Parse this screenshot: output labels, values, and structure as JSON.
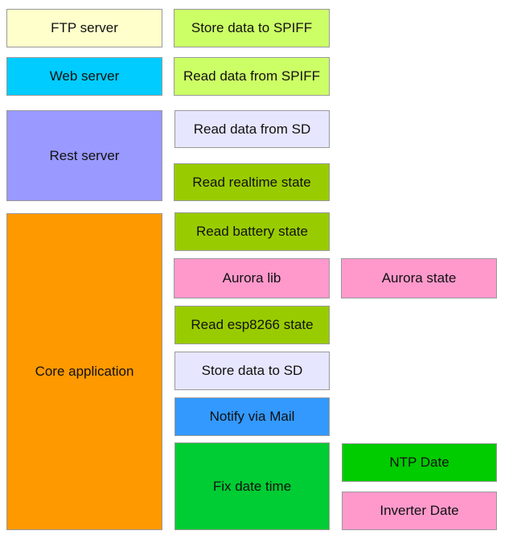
{
  "diagram": {
    "boxes": {
      "ftp_server": {
        "label": "FTP server",
        "color": "#ffffcc"
      },
      "web_server": {
        "label": "Web server",
        "color": "#00ccff"
      },
      "rest_server": {
        "label": "Rest server",
        "color": "#9999ff"
      },
      "core_application": {
        "label": "Core application",
        "color": "#ff9900"
      },
      "store_spiff": {
        "label": "Store data to SPIFF",
        "color": "#ccff66"
      },
      "read_spiff": {
        "label": "Read data from SPIFF",
        "color": "#ccff66"
      },
      "read_sd": {
        "label": "Read data from SD",
        "color": "#e6e6ff"
      },
      "read_realtime": {
        "label": "Read realtime state",
        "color": "#99cc00"
      },
      "read_battery": {
        "label": "Read battery state",
        "color": "#99cc00"
      },
      "aurora_lib": {
        "label": "Aurora lib",
        "color": "#ff99cc"
      },
      "aurora_state": {
        "label": "Aurora state",
        "color": "#ff99cc"
      },
      "read_esp8266": {
        "label": "Read esp8266 state",
        "color": "#99cc00"
      },
      "store_sd": {
        "label": "Store data to SD",
        "color": "#e6e6ff"
      },
      "notify_mail": {
        "label": "Notify via Mail",
        "color": "#3399ff"
      },
      "fix_date_time": {
        "label": "Fix date time",
        "color": "#00cc33"
      },
      "ntp_date": {
        "label": "NTP Date",
        "color": "#00cc00"
      },
      "inverter_date": {
        "label": "Inverter Date",
        "color": "#ff99cc"
      }
    }
  }
}
